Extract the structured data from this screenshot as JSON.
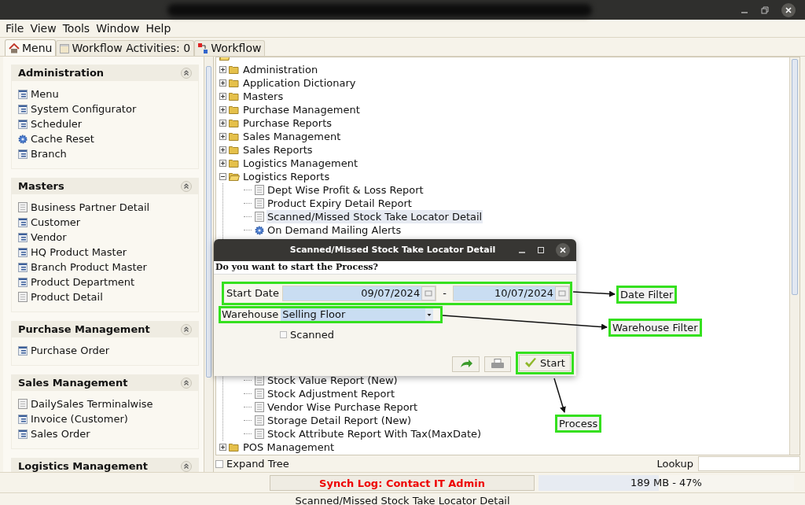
{
  "menu_bar": [
    "File",
    "View",
    "Tools",
    "Window",
    "Help"
  ],
  "tabs": [
    {
      "label": "Menu",
      "selected": true
    },
    {
      "label": "Workflow Activities: 0",
      "selected": false
    },
    {
      "label": "Workflow",
      "selected": false
    }
  ],
  "sidebar": {
    "groups": [
      {
        "title": "Administration",
        "expanded": true,
        "items": [
          {
            "label": "Menu",
            "kind": "window"
          },
          {
            "label": "System Configurator",
            "kind": "window"
          },
          {
            "label": "Scheduler",
            "kind": "window"
          },
          {
            "label": "Cache Reset",
            "kind": "process"
          },
          {
            "label": "Branch",
            "kind": "window"
          }
        ]
      },
      {
        "title": "Masters",
        "expanded": true,
        "items": [
          {
            "label": "Business Partner Detail",
            "kind": "report"
          },
          {
            "label": "Customer",
            "kind": "window"
          },
          {
            "label": "Vendor",
            "kind": "window"
          },
          {
            "label": "HQ Product Master",
            "kind": "window"
          },
          {
            "label": "Branch Product Master",
            "kind": "window"
          },
          {
            "label": "Product Department",
            "kind": "window"
          },
          {
            "label": "Product Detail",
            "kind": "report"
          }
        ]
      },
      {
        "title": "Purchase Management",
        "expanded": true,
        "items": [
          {
            "label": "Purchase Order",
            "kind": "window"
          }
        ]
      },
      {
        "title": "Sales Management",
        "expanded": true,
        "items": [
          {
            "label": "DailySales Terminalwise",
            "kind": "report"
          },
          {
            "label": "Invoice (Customer)",
            "kind": "window"
          },
          {
            "label": "Sales Order",
            "kind": "window"
          }
        ]
      },
      {
        "title": "Logistics Management",
        "expanded": true
      }
    ]
  },
  "tree": {
    "root": {
      "children": [
        {
          "label": "Administration",
          "kind": "folder",
          "expanded": false,
          "selected": false
        },
        {
          "label": "Application Dictionary",
          "kind": "folder",
          "expanded": false,
          "selected": false
        },
        {
          "label": "Masters",
          "kind": "folder",
          "expanded": false,
          "selected": false
        },
        {
          "label": "Purchase Management",
          "kind": "folder",
          "expanded": false,
          "selected": false
        },
        {
          "label": "Purchase Reports",
          "kind": "folder",
          "expanded": false,
          "selected": false
        },
        {
          "label": "Sales Management",
          "kind": "folder",
          "expanded": false,
          "selected": false
        },
        {
          "label": "Sales Reports",
          "kind": "folder",
          "expanded": false,
          "selected": false
        },
        {
          "label": "Logistics Management",
          "kind": "folder",
          "expanded": false,
          "selected": false
        },
        {
          "label": "Logistics Reports",
          "kind": "folder",
          "expanded": true,
          "selected": false,
          "children": [
            {
              "label": "Dept Wise Profit & Loss Report",
              "kind": "report",
              "selected": false
            },
            {
              "label": "Product Expiry Detail Report",
              "kind": "report",
              "selected": false
            },
            {
              "label": "Scanned/Missed Stock Take Locator Detail",
              "kind": "report",
              "selected": true
            },
            {
              "label": "On Demand Mailing Alerts",
              "kind": "process",
              "selected": false
            },
            {
              "kind": "hidden"
            },
            {
              "label": "Stock Value Report (New)",
              "kind": "report",
              "selected": false
            },
            {
              "label": "Stock Adjustment Report",
              "kind": "report",
              "selected": false
            },
            {
              "label": "Vendor Wise Purchase Report",
              "kind": "report",
              "selected": false
            },
            {
              "label": "Storage Detail Report (New)",
              "kind": "report",
              "selected": false
            },
            {
              "label": "Stock Attribute Report With Tax(MaxDate)",
              "kind": "report",
              "selected": false
            }
          ]
        },
        {
          "label": "POS Management",
          "kind": "folder",
          "expanded": false,
          "selected": false
        }
      ]
    }
  },
  "expand_tree": {
    "label": "Expand Tree",
    "checked": false
  },
  "lookup": {
    "label": "Lookup"
  },
  "status": {
    "sync_log": "Synch Log: Contact IT Admin",
    "memory": {
      "reading": "189 MB - 47%",
      "level": 0.47
    },
    "message": "Scanned/Missed Stock Take Locator Detail"
  },
  "dialog": {
    "title": "Scanned/Missed Stock Take Locator Detail",
    "prompt": "Do you want to start the Process?",
    "start_date": {
      "label": "Start Date",
      "from": "09/07/2024",
      "separator": "-",
      "to": "10/07/2024"
    },
    "warehouse": {
      "label": "Warehouse",
      "value": "Selling Floor"
    },
    "scanned": {
      "label": "Scanned",
      "checked": false
    },
    "buttons": [
      {
        "kind": "refresh"
      },
      {
        "kind": "print"
      },
      {
        "kind": "start",
        "label": "Start"
      }
    ]
  },
  "annotations": [
    {
      "label": "Date Filter"
    },
    {
      "label": "Warehouse Filter"
    },
    {
      "label": "Process"
    }
  ]
}
